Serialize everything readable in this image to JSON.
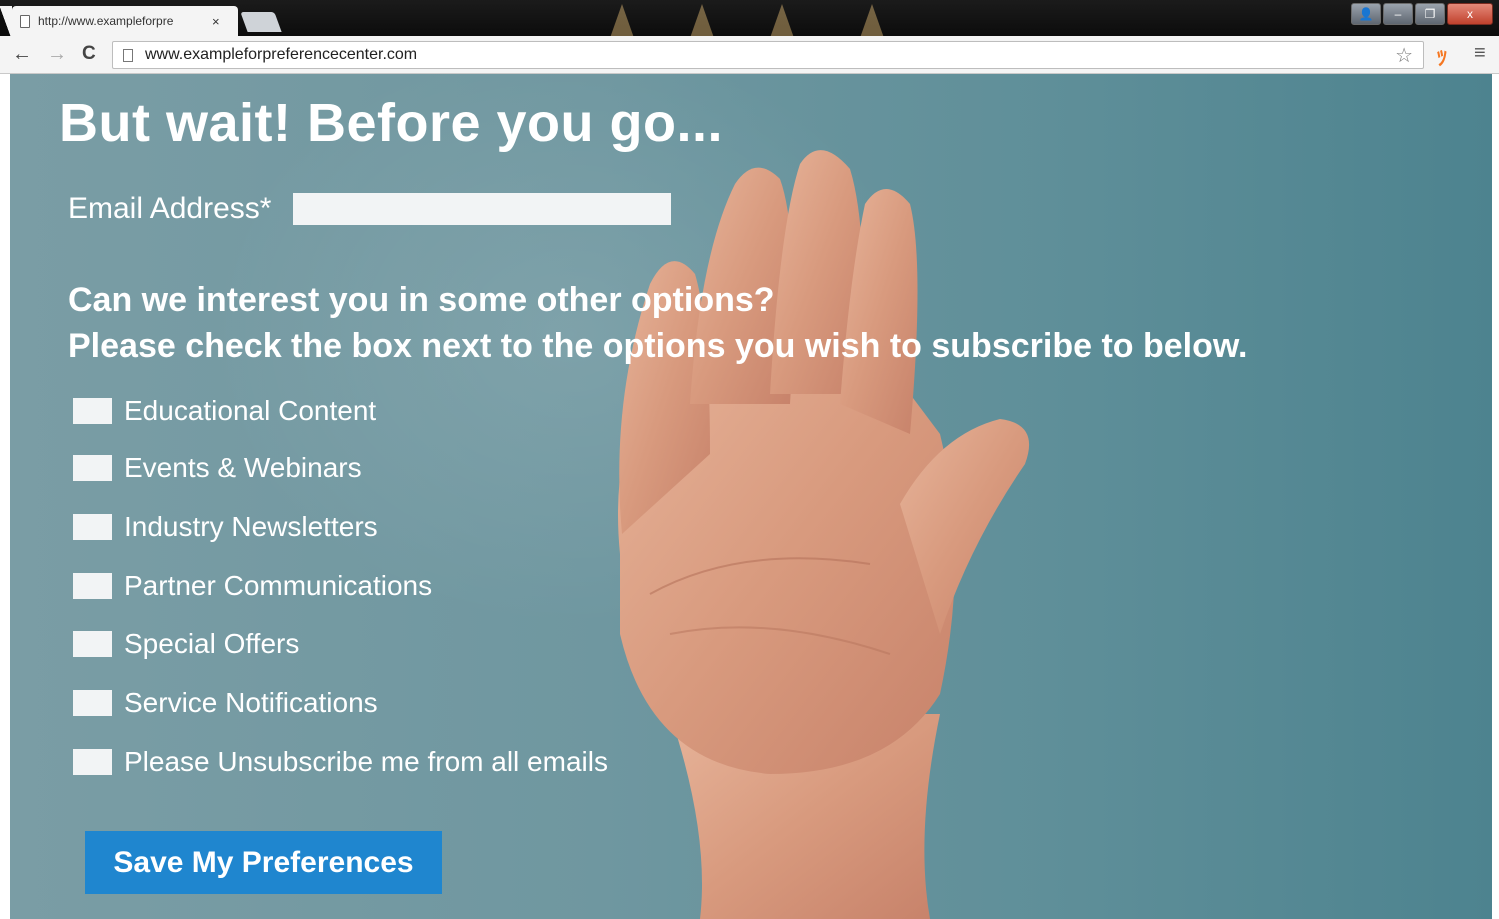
{
  "browser": {
    "tab_title": "http://www.exampleforpre",
    "tab_close": "×",
    "url": "www.exampleforpreferencecenter.com",
    "nav": {
      "back": "←",
      "forward": "→",
      "reload": "C"
    },
    "window_controls": {
      "user": "👤",
      "minimize": "–",
      "restore": "❐",
      "close": "x"
    },
    "star": "☆",
    "extension": "ﾂ",
    "menu": "≡"
  },
  "page": {
    "heading": "But wait! Before you go...",
    "email_label": "Email Address*",
    "email_value": "",
    "subheading_line1": "Can we interest you in some other options?",
    "subheading_line2": "Please check the box next to the options you wish to subscribe to below.",
    "options": [
      {
        "label": "Educational Content",
        "checked": false
      },
      {
        "label": "Events & Webinars",
        "checked": false
      },
      {
        "label": "Industry Newsletters",
        "checked": false
      },
      {
        "label": "Partner Communications",
        "checked": false
      },
      {
        "label": "Special Offers",
        "checked": false
      },
      {
        "label": "Service Notifications",
        "checked": false
      },
      {
        "label": "Please Unsubscribe me from all emails",
        "checked": false
      }
    ],
    "save_button": "Save My Preferences"
  },
  "colors": {
    "background_teal": "#6f97a0",
    "button_blue": "#1f86cf",
    "input_fill": "#f2f4f5",
    "text": "#ffffff"
  }
}
